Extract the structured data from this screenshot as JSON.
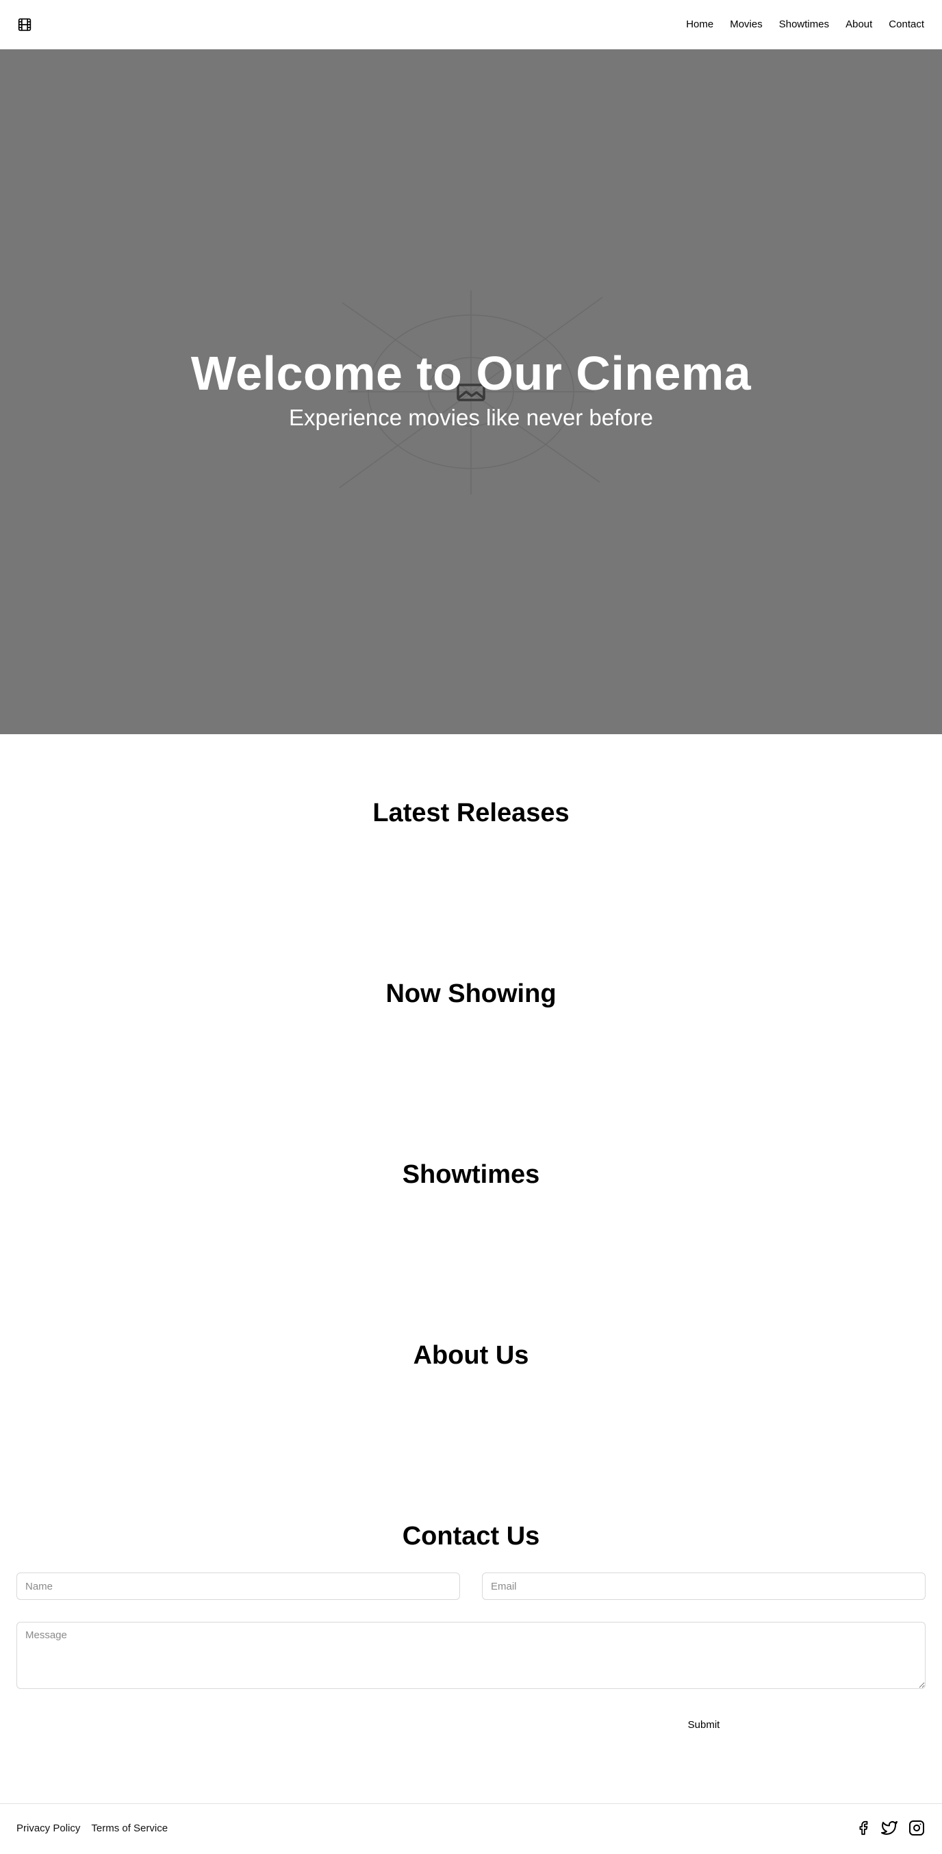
{
  "header": {
    "logo_icon": "film-icon",
    "nav": [
      "Home",
      "Movies",
      "Showtimes",
      "About",
      "Contact"
    ]
  },
  "hero": {
    "title": "Welcome to Our Cinema",
    "subtitle": "Experience movies like never before",
    "background_color": "#777777",
    "placeholder_icon": "image-icon"
  },
  "sections": {
    "latest_releases": "Latest Releases",
    "now_showing": "Now Showing",
    "showtimes": "Showtimes",
    "about": "About Us",
    "contact": "Contact Us"
  },
  "contact_form": {
    "name_placeholder": "Name",
    "email_placeholder": "Email",
    "message_placeholder": "Message",
    "submit_label": "Submit"
  },
  "footer": {
    "links": [
      "Privacy Policy",
      "Terms of Service"
    ],
    "social_icons": [
      "facebook-icon",
      "twitter-icon",
      "instagram-icon"
    ]
  }
}
